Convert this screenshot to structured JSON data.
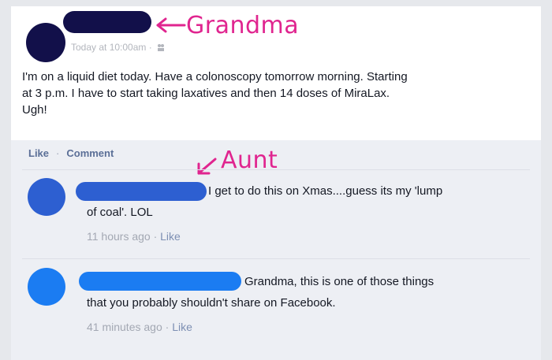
{
  "post": {
    "meta": "Today at 10:00am ·",
    "text_line1": "I'm on a liquid diet today. Have a colonoscopy tomorrow morning. Starting",
    "text_line2": "at 3 p.m. I have to start taking laxatives and then 14 doses of MiraLax.",
    "text_line3": "Ugh!"
  },
  "actions": {
    "like": "Like",
    "separator": "·",
    "comment": "Comment"
  },
  "annotations": {
    "grandma": "Grandma",
    "aunt": "Aunt",
    "color": "#e0258f"
  },
  "comments": [
    {
      "line1": "I get to do this on Xmas....guess its my 'lump",
      "line2": "of coal'. LOL",
      "time": "11 hours ago ·",
      "like": "Like",
      "avatar_color": "#2d5fd1"
    },
    {
      "line1": "Grandma, this is one of those things",
      "line2": "that you probably shouldn't share on Facebook.",
      "time": "41 minutes ago ·",
      "like": "Like",
      "avatar_color": "#1b7cf2"
    }
  ],
  "colors": {
    "post_redaction": "#12104a",
    "link": "#5b6f97",
    "comment_bg": "#edeff4"
  },
  "icons": [
    "privacy-icon",
    "arrow-left-icon",
    "arrow-down-left-icon"
  ]
}
